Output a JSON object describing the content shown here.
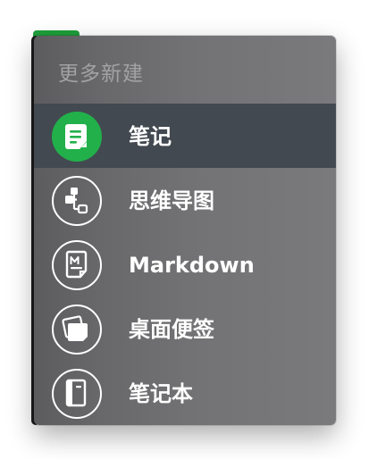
{
  "menu": {
    "header": "更多新建",
    "items": [
      {
        "label": "笔记",
        "icon": "note-icon"
      },
      {
        "label": "思维导图",
        "icon": "mind-map-icon"
      },
      {
        "label": "Markdown",
        "icon": "markdown-icon"
      },
      {
        "label": "桌面便签",
        "icon": "sticky-note-icon"
      },
      {
        "label": "笔记本",
        "icon": "notebook-icon"
      }
    ],
    "selected_index": 0
  },
  "colors": {
    "accent": "#22b04b",
    "selected_row": "#424950",
    "menu_background": "#6e6e70",
    "header_text": "#a2a2a4",
    "item_text": "#ffffff"
  }
}
